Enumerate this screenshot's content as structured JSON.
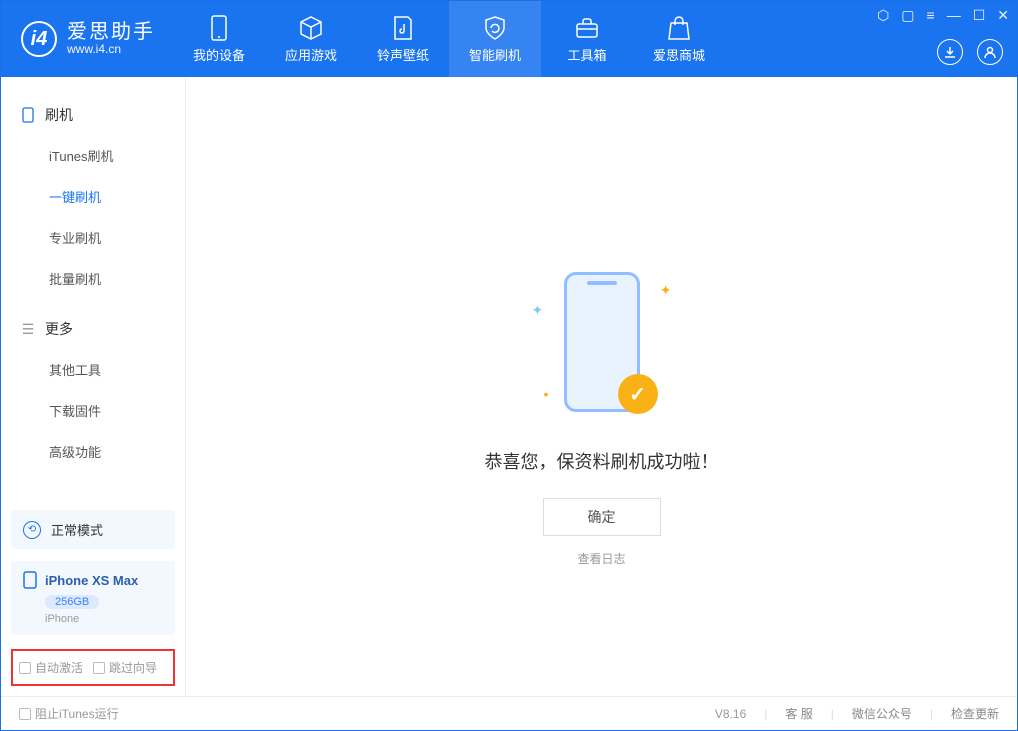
{
  "app": {
    "name": "爱思助手",
    "url": "www.i4.cn"
  },
  "nav": {
    "items": [
      {
        "label": "我的设备"
      },
      {
        "label": "应用游戏"
      },
      {
        "label": "铃声壁纸"
      },
      {
        "label": "智能刷机"
      },
      {
        "label": "工具箱"
      },
      {
        "label": "爱思商城"
      }
    ]
  },
  "sidebar": {
    "section1": {
      "title": "刷机",
      "items": [
        {
          "label": "iTunes刷机"
        },
        {
          "label": "一键刷机"
        },
        {
          "label": "专业刷机"
        },
        {
          "label": "批量刷机"
        }
      ]
    },
    "section2": {
      "title": "更多",
      "items": [
        {
          "label": "其他工具"
        },
        {
          "label": "下载固件"
        },
        {
          "label": "高级功能"
        }
      ]
    },
    "mode": "正常模式",
    "device": {
      "name": "iPhone XS Max",
      "storage": "256GB",
      "type": "iPhone"
    },
    "options": {
      "auto_activate": "自动激活",
      "skip_guide": "跳过向导"
    }
  },
  "main": {
    "success_message": "恭喜您，保资料刷机成功啦！",
    "ok_button": "确定",
    "view_log": "查看日志"
  },
  "footer": {
    "block_itunes": "阻止iTunes运行",
    "version": "V8.16",
    "links": {
      "support": "客 服",
      "wechat": "微信公众号",
      "update": "检查更新"
    }
  }
}
